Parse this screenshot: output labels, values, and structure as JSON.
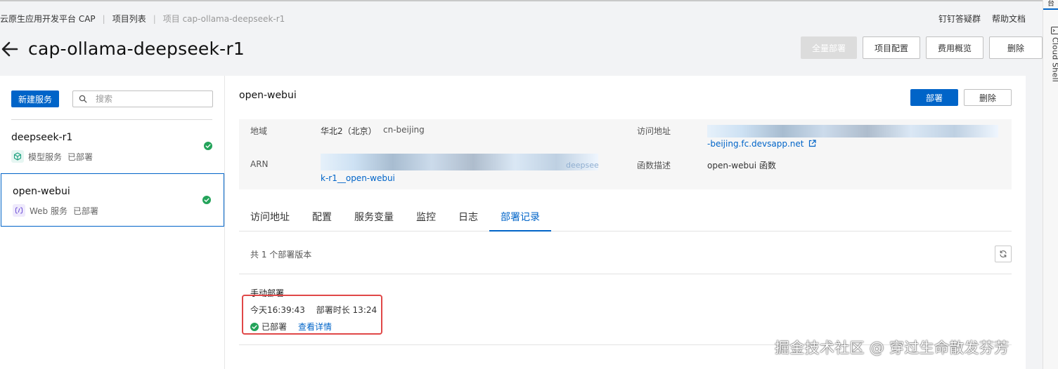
{
  "breadcrumb": {
    "items": [
      "云原生应用开发平台 CAP",
      "项目列表"
    ],
    "current": "项目 cap-ollama-deepseek-r1"
  },
  "top_links": {
    "dingtalk": "钉钉答疑群",
    "help": "帮助文档"
  },
  "header": {
    "title": "cap-ollama-deepseek-r1",
    "actions": {
      "deploy_all": "全量部署",
      "project_config": "项目配置",
      "cost_overview": "费用概览",
      "delete": "删除"
    }
  },
  "sidebar": {
    "new_service": "新建服务",
    "search_placeholder": "搜索",
    "services": [
      {
        "name": "deepseek-r1",
        "type": "模型服务",
        "status": "已部署"
      },
      {
        "name": "open-webui",
        "type": "Web 服务",
        "status": "已部署"
      }
    ]
  },
  "detail": {
    "service_title": "open-webui",
    "deploy_button": "部署",
    "delete_button": "删除",
    "info": {
      "region_label": "地域",
      "region_name": "华北2（北京）",
      "region_id": "cn-beijing",
      "access_label": "访问地址",
      "access_url_tail": "-beijing.fc.devsapp.net",
      "arn_label": "ARN",
      "arn_tail": "k-r1__open-webui",
      "arn_partial": "deepsee",
      "desc_label": "函数描述",
      "desc_value": "open-webui 函数"
    },
    "tabs": [
      "访问地址",
      "配置",
      "服务变量",
      "监控",
      "日志",
      "部署记录"
    ],
    "active_tab": "部署记录",
    "records": {
      "count_text": "共 1 个部署版本",
      "items": [
        {
          "title": "手动部署",
          "time": "今天16:39:43",
          "duration": "部署时长 13:24",
          "status": "已部署",
          "detail_link": "查看详情"
        }
      ]
    }
  },
  "edge": {
    "top_label": "台",
    "cloud_shell": "Cloud Shell"
  },
  "watermark": "掘金技术社区 @ 穿过生命散发芬芳",
  "colors": {
    "accent": "#0064c8",
    "success": "#23a35a",
    "highlight": "#e04848"
  }
}
